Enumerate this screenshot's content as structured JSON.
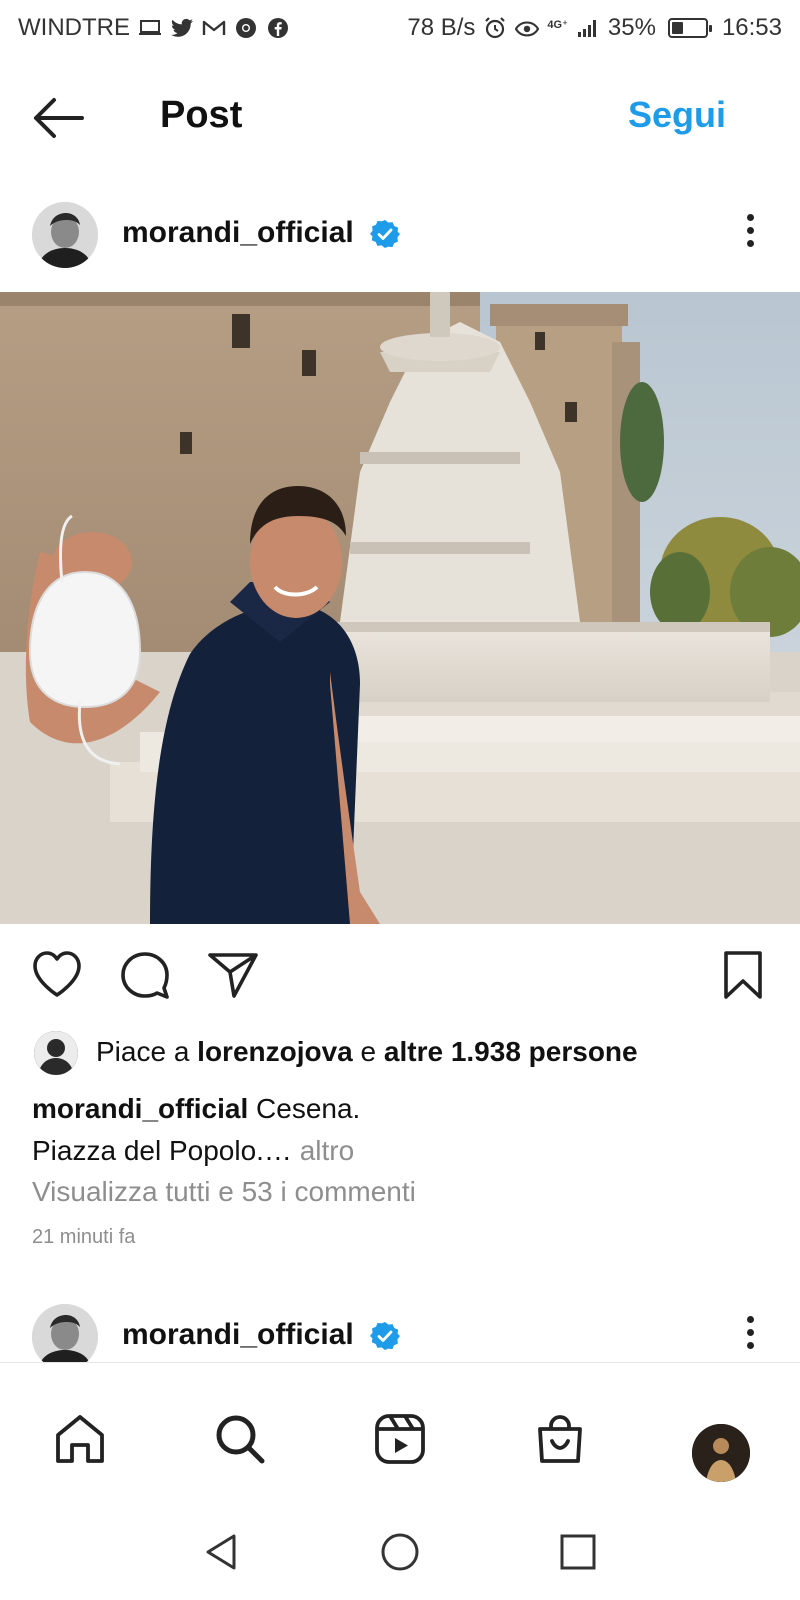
{
  "status_bar": {
    "carrier": "WINDTRE",
    "net_speed": "78 B/s",
    "battery": "35%",
    "battery_level": 0.35,
    "time": "16:53",
    "network": "4G⁺"
  },
  "header": {
    "title": "Post",
    "follow_label": "Segui"
  },
  "post": {
    "username": "morandi_official",
    "verified": true,
    "likes": {
      "prefix": "Piace a ",
      "user": "lorenzojova",
      "middle": " e ",
      "others": "altre 1.938 persone"
    },
    "caption": {
      "username": "morandi_official",
      "line1": "Cesena.",
      "line2": "Piazza del Popolo.…",
      "more": "altro"
    },
    "comments_link": "Visualizza tutti e 53 i commenti",
    "timestamp": "21 minuti fa"
  },
  "next_post": {
    "username": "morandi_official"
  },
  "icons": {
    "like": "heart-icon",
    "comment": "comment-icon",
    "share": "send-icon",
    "save": "bookmark-icon",
    "home": "home-icon",
    "search": "search-icon",
    "reels": "reels-icon",
    "shop": "shop-icon"
  },
  "colors": {
    "accent": "#1e9be9",
    "secondary_text": "#8e8e8e",
    "verified": "#1e9be9"
  }
}
